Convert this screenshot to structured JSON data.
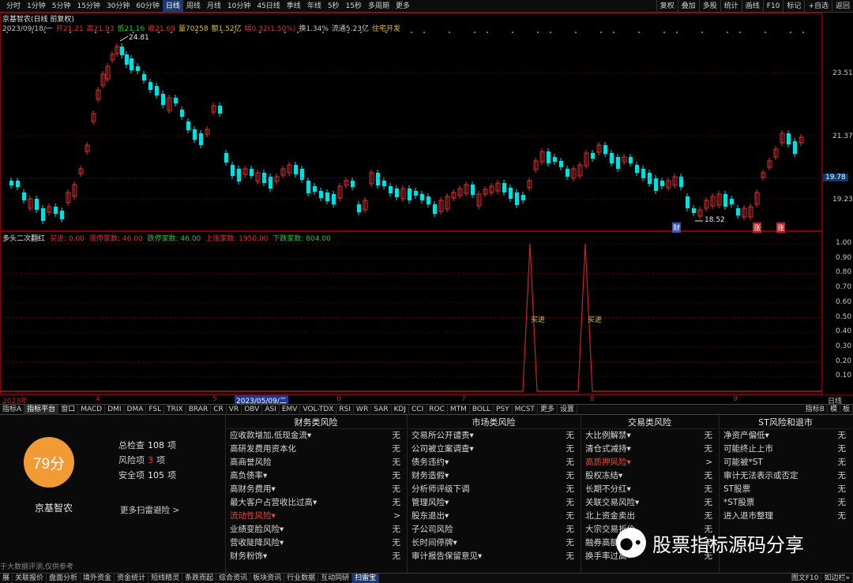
{
  "topbar": {
    "periods": [
      "分时",
      "1分钟",
      "5分钟",
      "15分钟",
      "30分钟",
      "60分钟",
      "日线",
      "周线",
      "月线",
      "10分钟",
      "45日线",
      "季线",
      "年线",
      "5秒",
      "15秒",
      "多周期",
      "更多"
    ],
    "active_period": "日线",
    "tools": [
      "复权",
      "叠加",
      "多股",
      "统计",
      "画线",
      "F10",
      "+自选",
      "返回"
    ],
    "tool_labels": [
      "复权",
      "叠加",
      "多股",
      "统计",
      "画线",
      "F10",
      "标记",
      "+自选",
      "返回"
    ]
  },
  "main_chart": {
    "title": "京基智农(日线 前复权)",
    "info": {
      "date": "2023/09/18/一",
      "open": "开21.21",
      "high": "高21.93",
      "low": "低21.16",
      "close": "收21.69",
      "volume": "量70258",
      "amount": "额1.52亿",
      "change": "幅0.32(1.50%)",
      "turnover": "换1.34%",
      "float_cap": "流通5.23亿",
      "concept": "住宅开发"
    },
    "price_axis": [
      "23.51",
      "21.37",
      "19.23"
    ],
    "current_price": "19.78",
    "high_mark": "24.81",
    "low_mark": "18.52",
    "markers": {
      "cai": "财",
      "zhang": "涨",
      "zhang2": "涨"
    }
  },
  "indicator": {
    "name": "多头二次翻红",
    "values": [
      {
        "text": "买进: 0.00",
        "color": "#e03030"
      },
      {
        "text": "涨停家数: 46.00",
        "color": "#e03030"
      },
      {
        "text": "跌停家数: 46.00",
        "color": "#30c030"
      },
      {
        "text": "上涨家数: 1950.00",
        "color": "#e03030"
      },
      {
        "text": "下跌家数: 804.00",
        "color": "#30c030"
      }
    ],
    "axis": [
      "1.00",
      "0.90",
      "0.80",
      "0.70",
      "0.60",
      "0.50",
      "0.40",
      "0.30",
      "0.20",
      "0.10"
    ],
    "signals": [
      "买进",
      "买进"
    ]
  },
  "time_axis": {
    "labels": [
      "2023年",
      "4",
      "5",
      "2023/05/09/二",
      "6",
      "7",
      "8",
      "9"
    ],
    "period": "日线"
  },
  "tabs": {
    "items": [
      "指标A",
      "指标平台",
      "窗口",
      "MACD",
      "DMI",
      "DMA",
      "FSL",
      "TRIX",
      "BRAR",
      "CR",
      "VR",
      "OBV",
      "ASI",
      "EMV",
      "VOL-TDX",
      "RSI",
      "WR",
      "SAR",
      "KDJ",
      "CCI",
      "ROC",
      "MTM",
      "BOLL",
      "PSY",
      "MCST",
      "更多",
      "设置"
    ],
    "active": "指标平台",
    "right": [
      "指标B",
      "模",
      "板"
    ]
  },
  "risk": {
    "score": "79分",
    "stock_name": "京基智农",
    "total_label": "总检查",
    "total_value": "108",
    "unit": "项",
    "risk_label": "风险项",
    "risk_value": "3",
    "safe_label": "安全项",
    "safe_value": "105",
    "more_link": "更多扫雷避险 >",
    "disclaimer": "于大数据评测,仅供参考",
    "columns": [
      {
        "title": "财务类风险",
        "items": [
          {
            "t": "应收款增加,低现金流▾",
            "v": "无"
          },
          {
            "t": "高研发费用资本化",
            "v": "无"
          },
          {
            "t": "高商誉风险",
            "v": "无"
          },
          {
            "t": "高负债率▾",
            "v": "无"
          },
          {
            "t": "高财务费用▾",
            "v": "无"
          },
          {
            "t": "最大客户占营收比过高▾",
            "v": "无"
          },
          {
            "t": "流动性风险▾",
            "v": ">",
            "red": true
          },
          {
            "t": "业绩变脸风险▾",
            "v": "无"
          },
          {
            "t": "营收陡降风险▾",
            "v": "无"
          },
          {
            "t": "财务粉饰▾",
            "v": "无"
          }
        ]
      },
      {
        "title": "市场类风险",
        "items": [
          {
            "t": "交易所公开谴责▾",
            "v": "无"
          },
          {
            "t": "公司被立案调查▾",
            "v": "无"
          },
          {
            "t": "债务违约▾",
            "v": "无"
          },
          {
            "t": "财务造假▾",
            "v": "无"
          },
          {
            "t": "分析师评级下调",
            "v": "无"
          },
          {
            "t": "管理风险▾",
            "v": "无"
          },
          {
            "t": "股东退出▾",
            "v": "无"
          },
          {
            "t": "子公司风险",
            "v": "无"
          },
          {
            "t": "长时间停牌▾",
            "v": "无"
          },
          {
            "t": "审计报告保留意见▾",
            "v": "无"
          }
        ]
      },
      {
        "title": "交易类风险",
        "items": [
          {
            "t": "大比例解禁▾",
            "v": "无"
          },
          {
            "t": "清仓式减持▾",
            "v": "无"
          },
          {
            "t": "高质押风险▾",
            "v": ">",
            "red": true
          },
          {
            "t": "股权冻结▾",
            "v": "无"
          },
          {
            "t": "长期不分红▾",
            "v": "无"
          },
          {
            "t": "关联交易风险▾",
            "v": "无"
          },
          {
            "t": "北上资金卖出",
            "v": "无"
          },
          {
            "t": "大宗交易折价",
            "v": "无"
          },
          {
            "t": "融券高额",
            "v": "无"
          },
          {
            "t": "换手率过高▾",
            "v": "无"
          }
        ]
      },
      {
        "title": "ST风险和退市",
        "items": [
          {
            "t": "净资产偏低▾",
            "v": "无"
          },
          {
            "t": "可能终止上市",
            "v": "无"
          },
          {
            "t": "可能被*ST",
            "v": "无"
          },
          {
            "t": "审计无法表示或否定",
            "v": "无"
          },
          {
            "t": "ST股票",
            "v": "无"
          },
          {
            "t": "*ST股票",
            "v": "无"
          },
          {
            "t": "进入退市整理",
            "v": "无"
          }
        ]
      }
    ]
  },
  "watermark": {
    "text": "股票指标源码分享",
    "icon": "wechat-icon"
  },
  "bottombar": {
    "items": [
      "展",
      "关联报价",
      "盘面分析",
      "境外资金",
      "资金统计",
      "短线精灵",
      "条跌而起",
      "综合资讯",
      "板块资讯",
      "行业数据",
      "互动同研",
      "扫雷宝"
    ],
    "active": "扫雷宝",
    "right": [
      "图文F10",
      "如边栏»"
    ]
  },
  "colors": {
    "up": "#e03030",
    "down": "#00e0e0",
    "indicator_line": "#d02020",
    "score_bg": "#f29a34"
  }
}
